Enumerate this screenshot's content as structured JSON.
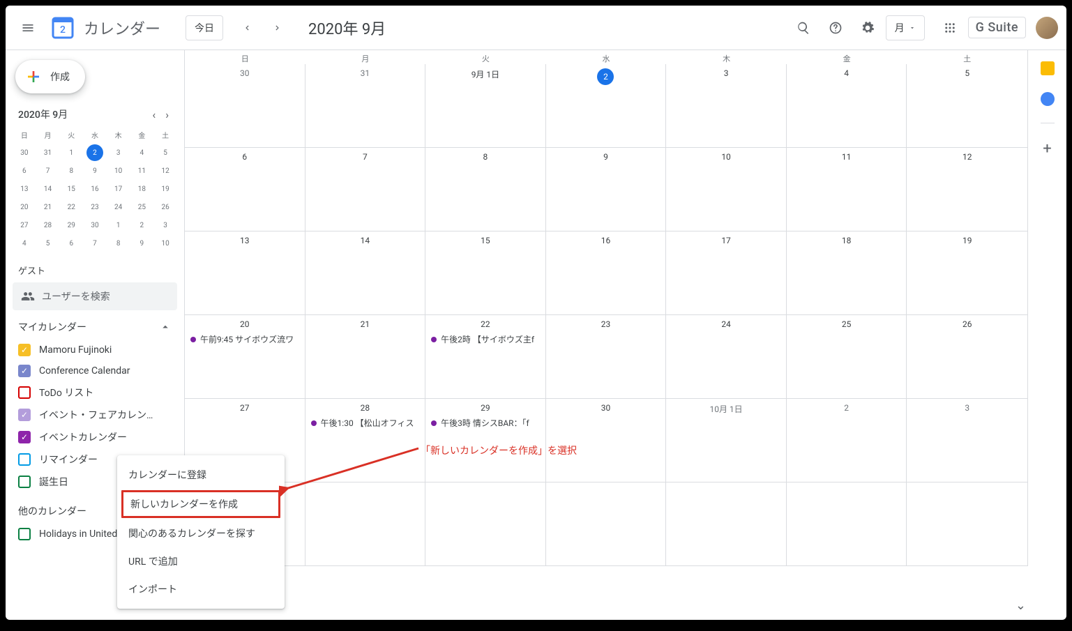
{
  "header": {
    "app_title": "カレンダー",
    "today_btn": "今日",
    "month_label": "2020年 9月",
    "view_label": "月",
    "gsuite_label": "G Suite",
    "logo_day": "2"
  },
  "sidebar": {
    "create": "作成",
    "mini_title": "2020年 9月",
    "dow": [
      "日",
      "月",
      "火",
      "水",
      "木",
      "金",
      "土"
    ],
    "mini_weeks": [
      [
        "30",
        "31",
        "1",
        "2",
        "3",
        "4",
        "5"
      ],
      [
        "6",
        "7",
        "8",
        "9",
        "10",
        "11",
        "12"
      ],
      [
        "13",
        "14",
        "15",
        "16",
        "17",
        "18",
        "19"
      ],
      [
        "20",
        "21",
        "22",
        "23",
        "24",
        "25",
        "26"
      ],
      [
        "27",
        "28",
        "29",
        "30",
        "1",
        "2",
        "3"
      ],
      [
        "4",
        "5",
        "6",
        "7",
        "8",
        "9",
        "10"
      ]
    ],
    "mini_today": "2",
    "guest_label": "ゲスト",
    "guest_placeholder": "ユーザーを検索",
    "my_cal_label": "マイカレンダー",
    "my_cals": [
      {
        "label": "Mamoru Fujinoki",
        "color": "#f6bf26",
        "checked": true
      },
      {
        "label": "Conference Calendar",
        "color": "#7986cb",
        "checked": true
      },
      {
        "label": "ToDo リスト",
        "color": "#d50000",
        "checked": false
      },
      {
        "label": "イベント・フェアカレン…",
        "color": "#b39ddb",
        "checked": true
      },
      {
        "label": "イベントカレンダー",
        "color": "#8e24aa",
        "checked": true
      },
      {
        "label": "リマインダー",
        "color": "#039be5",
        "checked": false
      },
      {
        "label": "誕生日",
        "color": "#0b8043",
        "checked": false
      }
    ],
    "other_cal_label": "他のカレンダー",
    "other_cals": [
      {
        "label": "Holidays in United",
        "color": "#0b8043",
        "checked": false
      }
    ]
  },
  "grid": {
    "dow": [
      "日",
      "月",
      "火",
      "水",
      "木",
      "金",
      "土"
    ],
    "rows": [
      [
        {
          "n": "30",
          "other": true
        },
        {
          "n": "31",
          "other": true
        },
        {
          "n": "9月 1日"
        },
        {
          "n": "2",
          "today": true
        },
        {
          "n": "3"
        },
        {
          "n": "4"
        },
        {
          "n": "5"
        }
      ],
      [
        {
          "n": "6"
        },
        {
          "n": "7"
        },
        {
          "n": "8"
        },
        {
          "n": "9"
        },
        {
          "n": "10"
        },
        {
          "n": "11"
        },
        {
          "n": "12"
        }
      ],
      [
        {
          "n": "13"
        },
        {
          "n": "14"
        },
        {
          "n": "15"
        },
        {
          "n": "16"
        },
        {
          "n": "17"
        },
        {
          "n": "18"
        },
        {
          "n": "19"
        }
      ],
      [
        {
          "n": "20",
          "events": [
            {
              "t": "午前9:45 サイボウズ流ワ"
            }
          ]
        },
        {
          "n": "21"
        },
        {
          "n": "22",
          "events": [
            {
              "t": "午後2時 【サイボウズ主f"
            }
          ]
        },
        {
          "n": "23"
        },
        {
          "n": "24"
        },
        {
          "n": "25"
        },
        {
          "n": "26"
        }
      ],
      [
        {
          "n": "27"
        },
        {
          "n": "28",
          "events": [
            {
              "t": "午後1:30 【松山オフィス"
            }
          ]
        },
        {
          "n": "29",
          "events": [
            {
              "t": "午後3時 情シスBAR：「f"
            }
          ]
        },
        {
          "n": "30"
        },
        {
          "n": "10月 1日",
          "other": true
        },
        {
          "n": "2",
          "other": true
        },
        {
          "n": "3",
          "other": true
        }
      ]
    ]
  },
  "popup": {
    "items": [
      "カレンダーに登録",
      "新しいカレンダーを作成",
      "関心のあるカレンダーを探す",
      "URL で追加",
      "インポート"
    ],
    "highlight_index": 1
  },
  "annotation": "「新しいカレンダーを作成」を選択"
}
